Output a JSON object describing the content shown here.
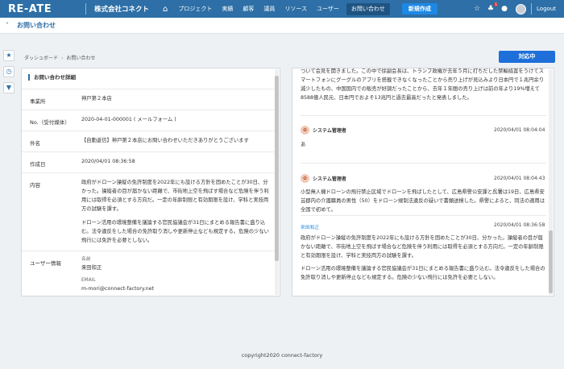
{
  "header": {
    "logo": "RE-ATE",
    "company": "株式会社コネクト",
    "nav": [
      "プロジェクト",
      "実績",
      "顧客",
      "議員",
      "リソース",
      "ユーザー"
    ],
    "active_nav": "お問い合わせ",
    "new_button": "新規作成",
    "notification_count": "1",
    "logout": "Logout"
  },
  "page": {
    "title": "お問い合わせ",
    "breadcrumb": [
      "ダッシュボード",
      "お問い合わせ"
    ],
    "action_button": "対応中"
  },
  "detail": {
    "section_title": "お問い合わせ詳細",
    "rows": [
      {
        "label": "事業所",
        "value": "神戸第２本店"
      },
      {
        "label": "No.（受付媒体）",
        "value": "2020-04-01-000001 ( メールフォーム )"
      },
      {
        "label": "件名",
        "value": "【自動返信】神戸第２本店にお問い合わせいただきありがとうございます"
      },
      {
        "label": "作成日",
        "value": "2020/04/01 08:36:58"
      },
      {
        "label": "内容",
        "lines": [
          "政府がドローン操縦の免許制度を2022年にも設ける方針を固めたことが30日、分かった。操縦者の目が届かない距離で、市街地上空を飛ばす場合など危険を伴う利用には取得を必須とする方向だ。一定の年齢制限と有効期限を設け、学科と実技両方の試験を課す。",
          "ドローン活用の環境整備を議論する官民協議会が31日にまとめる報告書に盛り込む。法令違反をした場合の免許取り消しや更新停止なども規定する。危険の少ない飛行には免許を必要としない。"
        ]
      },
      {
        "label": "ユーザー情報",
        "name_label": "名前",
        "name": "来田和正",
        "email_label": "EMAIL",
        "email": "m-mori@connect-factory.net"
      }
    ]
  },
  "messages": {
    "top_text": "ついて会見を開きました。この中で徐副会長は、トランプ政権が去年５月に打ちだした禁輸措置をうけてスマートフォンにグーグルのアプリを搭載できなくなったことから売り上げが見込みより日本円で１兆円余り減少したもの、中国国内での販売が好調だったことから、去年１年間の売り上げは前の年より19%増えて8588億人民元、日本円でおよそ13兆円と過去最高だったと発表しました。",
    "items": [
      {
        "sender": "システム管理者",
        "time": "2020/04/01 08:04:04",
        "text": "あ"
      },
      {
        "sender": "システム管理者",
        "time": "2020/04/01 08:04:43",
        "text": "小型無人機ドローンの飛行禁止区域でドローンを飛ばしたとして、広島県警公安課と呉署は19日、広島県安芸郡内の介護職員の男性（50）をドローン規制法違反の疑いで書類送検した。県警によると、同法の適用は全国で初めて。"
      }
    ],
    "reply_name": "来田和正",
    "reply_time": "2020/04/01 08:36:58",
    "reply_lines": [
      "政府がドローン操縦の免許制度を2022年にも設ける方針を固めたことが30日、分かった。操縦者の目が届かない距離で、市街地上空を飛ばす場合など危険を伴う利用には取得を必須とする方向だ。一定の年齢制限と有効期限を設け、学科と実技両方の試験を課す。",
      "ドローン活用の環境整備を議論する官民協議会が31日にまとめる報告書に盛り込む。法令違反をした場合の免許取り消しや更新停止なども規定する。危険の少ない飛行には免許を必要としない。"
    ]
  },
  "footer": "copyright2020 connect-factory"
}
